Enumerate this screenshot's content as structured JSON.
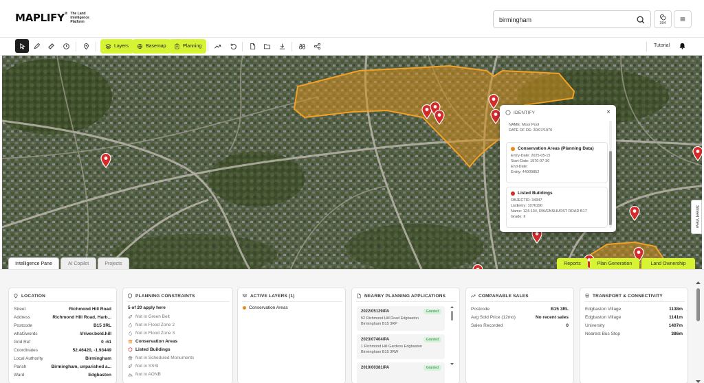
{
  "header": {
    "logo_text": "MAPLIFY",
    "logo_reg": "®",
    "logo_tagline": "The Land Intelligence Platform",
    "search_value": "birmingham",
    "credits_count": "394"
  },
  "toolbar": {
    "layers_label": "Layers",
    "basemap_label": "Basemap",
    "planning_label": "Planning",
    "tutorial_label": "Tutorial"
  },
  "map": {
    "identify": {
      "title": "IDENTIFY",
      "partial_lines": [
        "NAME: Moor Pool",
        "DATE OF DE: 30/07/1970"
      ],
      "conservation": {
        "title": "Conservation Areas (Planning Data)",
        "color": "#e8891c",
        "lines": [
          "Entry-Date: 2025-05-15",
          "Start-Date: 1970-07-30",
          "End-Date:",
          "Entity: 44009852"
        ]
      },
      "listed": {
        "title": "Listed Buildings",
        "color": "#d42a2a",
        "lines": [
          "OBJECTID: 34347",
          "ListEntry: 1076190",
          "Name: 124-134, RAVENSHURST ROAD B17",
          "Grade: II"
        ]
      }
    },
    "street_view_label": "Street View",
    "tabs": [
      "Intelligence Pane",
      "AI Copilot",
      "Projects"
    ],
    "green_tabs": [
      "Reports",
      "Plan Generation",
      "Land Ownership"
    ],
    "polygon_color": "#d4901e",
    "pin_color": "#d42a2a"
  },
  "panel": {
    "location": {
      "title": "LOCATION",
      "rows": [
        {
          "k": "Street",
          "v": "Richmond Hill Road"
        },
        {
          "k": "Address",
          "v": "Richmond Hill Road, Harb..."
        },
        {
          "k": "Postcode",
          "v": "B15 3RL"
        },
        {
          "k": "what3words",
          "v": "///river.bold.hill"
        },
        {
          "k": "Grid Ref",
          "v": "0 -61"
        },
        {
          "k": "Coordinates",
          "v": "52.46420, -1.93449"
        },
        {
          "k": "Local Authority",
          "v": "Birmingham"
        },
        {
          "k": "Parish",
          "v": "Birmingham, unparished a..."
        },
        {
          "k": "Ward",
          "v": "Edgbaston"
        }
      ]
    },
    "constraints": {
      "title": "PLANNING CONSTRAINTS",
      "summary": "5 of 20 apply here",
      "items": [
        {
          "label": "Not in Green Belt",
          "active": false
        },
        {
          "label": "Not in Flood Zone 2",
          "active": false
        },
        {
          "label": "Not in Flood Zone 3",
          "active": false
        },
        {
          "label": "Conservation Areas",
          "active": true
        },
        {
          "label": "Listed Buildings",
          "active": true
        },
        {
          "label": "Not in Scheduled Monuments",
          "active": false
        },
        {
          "label": "Not in SSSI",
          "active": false
        },
        {
          "label": "Not in AONB",
          "active": false
        }
      ]
    },
    "active_layers": {
      "title": "ACTIVE LAYERS (1)",
      "items": [
        {
          "label": "Conservation Areas",
          "color": "#e8891c"
        }
      ]
    },
    "nearby": {
      "title": "NEARBY PLANNING APPLICATIONS",
      "apps": [
        {
          "ref": "2022/05129/PA",
          "status": "Granted",
          "addr1": "52 Richmond Hill Road Edgbaston",
          "addr2": "Birmingham B15 3RP"
        },
        {
          "ref": "2023/07404/PA",
          "status": "Granted",
          "addr1": "1 Richmond Hill Gardens Edgbaston",
          "addr2": "Birmingham B15 3RW"
        },
        {
          "ref": "2010/00381/PA",
          "status": "Granted",
          "addr1": "",
          "addr2": ""
        }
      ]
    },
    "sales": {
      "title": "COMPARABLE SALES",
      "rows": [
        {
          "k": "Postcode",
          "v": "B15 3RL"
        },
        {
          "k": "Avg Sold Price (12mo)",
          "v": "No recent sales"
        },
        {
          "k": "Sales Recorded",
          "v": "0"
        }
      ]
    },
    "transport": {
      "title": "TRANSPORT & CONNECTIVITY",
      "rows": [
        {
          "k": "Edgbaston Village",
          "v": "1138m"
        },
        {
          "k": "Edgbaston Village",
          "v": "1141m"
        },
        {
          "k": "University",
          "v": "1407m"
        },
        {
          "k": "Nearest Bus Stop",
          "v": "386m"
        }
      ]
    }
  }
}
